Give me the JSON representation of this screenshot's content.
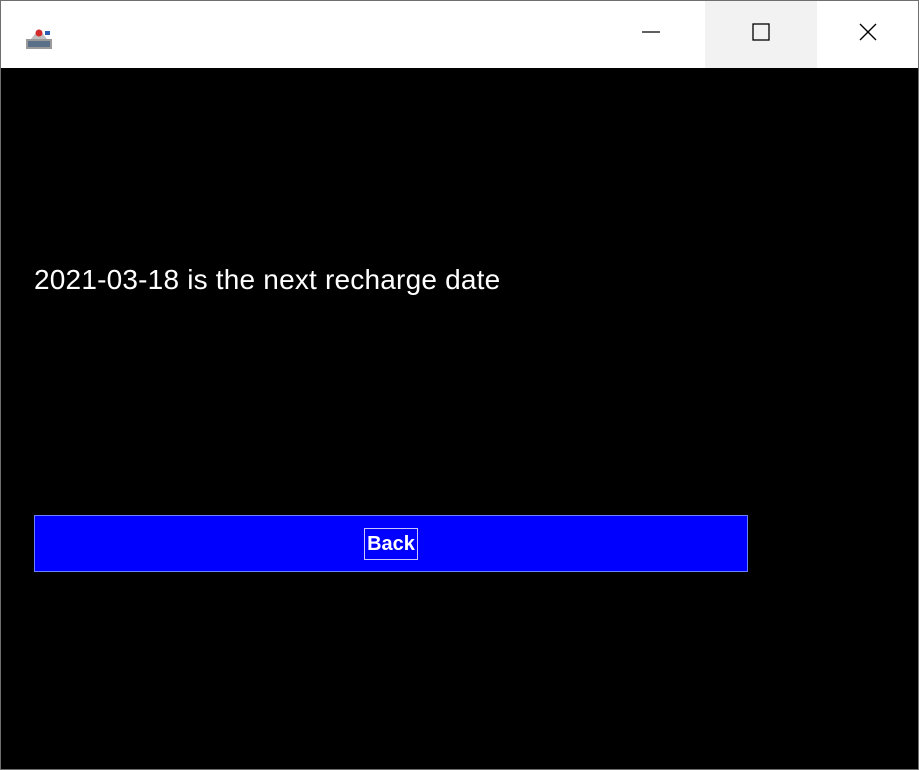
{
  "window": {
    "controls": {
      "minimize_icon": "minimize-icon",
      "maximize_icon": "maximize-icon",
      "close_icon": "close-icon"
    }
  },
  "content": {
    "message": "2021-03-18 is the next recharge date",
    "back_button_label": "Back"
  },
  "colors": {
    "background": "#000000",
    "button": "#0000ff",
    "text": "#ffffff"
  }
}
